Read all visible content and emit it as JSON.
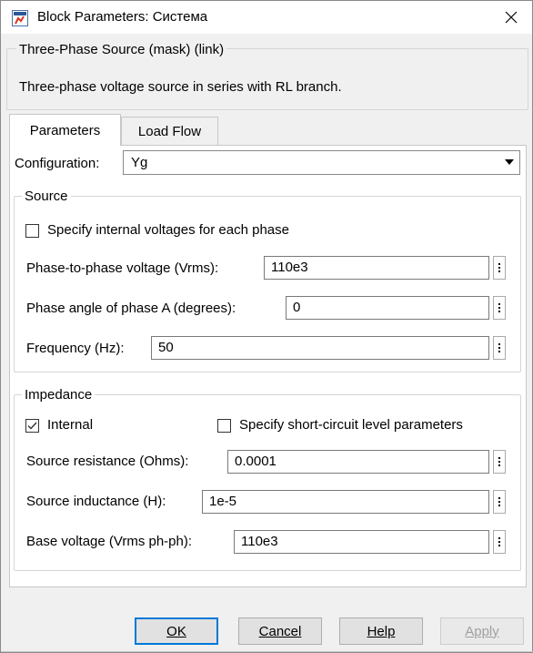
{
  "window": {
    "title": "Block Parameters: Система",
    "close_glyph": "✕"
  },
  "mask": {
    "heading": "Three-Phase Source (mask) (link)",
    "description": "Three-phase voltage source in series with RL branch."
  },
  "tabs": [
    {
      "label": "Parameters",
      "active": true
    },
    {
      "label": "Load Flow",
      "active": false
    }
  ],
  "configuration": {
    "label": "Configuration:",
    "value": "Yg"
  },
  "source": {
    "legend": "Source",
    "specify_internal": {
      "label": "Specify internal voltages for each phase",
      "checked": false
    },
    "phase_voltage": {
      "label": "Phase-to-phase voltage (Vrms):",
      "value": "110e3"
    },
    "phase_angle": {
      "label": "Phase angle of phase A (degrees):",
      "value": "0"
    },
    "frequency": {
      "label": "Frequency (Hz):",
      "value": "50"
    }
  },
  "impedance": {
    "legend": "Impedance",
    "internal": {
      "label": "Internal",
      "checked": true
    },
    "short_circuit": {
      "label": "Specify short-circuit level parameters",
      "checked": false
    },
    "resistance": {
      "label": "Source resistance (Ohms):",
      "value": "0.0001"
    },
    "inductance": {
      "label": "Source inductance (H):",
      "value": "1e-5"
    },
    "base_voltage": {
      "label": "Base voltage (Vrms ph-ph):",
      "value": "110e3"
    }
  },
  "buttons": {
    "ok": {
      "label": "OK",
      "enabled": true
    },
    "cancel": {
      "label": "Cancel",
      "enabled": true
    },
    "help": {
      "label": "Help",
      "enabled": true
    },
    "apply": {
      "label": "Apply",
      "enabled": false
    }
  },
  "colors": {
    "accent": "#0078d7",
    "checkmark": "#333333",
    "disabled_text": "#a0a0a0"
  },
  "icons": [
    "app-block-icon",
    "close-icon",
    "dropdown-arrow-icon",
    "ellipsis-menu-icon",
    "check-icon"
  ]
}
